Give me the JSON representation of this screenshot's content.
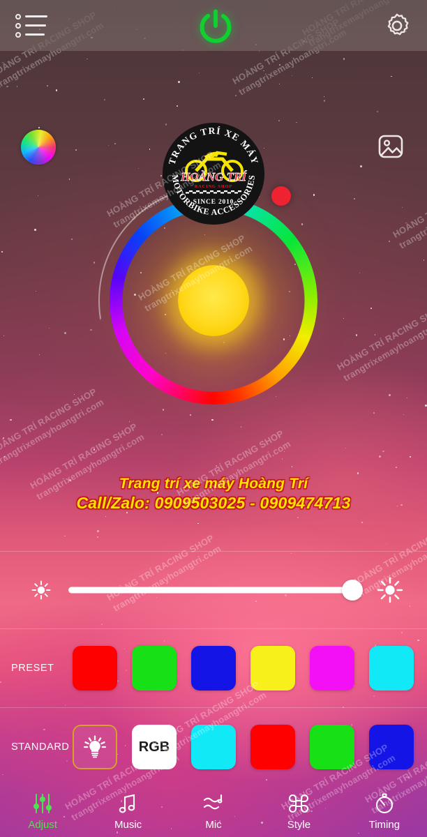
{
  "topbar": {
    "menu_icon": "list-menu-icon",
    "power_icon": "power-icon",
    "settings_icon": "gear-icon"
  },
  "header": {
    "color_wheel_icon": "color-wheel-icon",
    "gallery_icon": "image-gallery-icon",
    "logo": {
      "top_arc": "TRANG TRÍ XE MÁY",
      "bottom_arc": "MOTORBIKE ACCESSORIES",
      "brand": "HOÀNG TRÍ",
      "sub_brand": "RACING SHOP",
      "since": "SINCE 2010",
      "brand_color": "#e5182a",
      "accent_color": "#f5e400",
      "background_color": "#131313"
    }
  },
  "color_wheel": {
    "handle_color": "#ef2233",
    "handle_angle_deg": 45,
    "center_color": "#ffd91f",
    "selected_hue": "yellow"
  },
  "promo": {
    "line1": "Trang trí xe máy Hoàng Trí",
    "line2": "Call/Zalo: 0909503025 - 0909474713",
    "text_color": "#ffe000",
    "outline_color": "#c21717"
  },
  "brightness": {
    "low_icon": "sun-small-icon",
    "high_icon": "sun-large-icon",
    "value_percent": 96
  },
  "preset": {
    "label": "PRESET",
    "colors": [
      "#ff0000",
      "#17e017",
      "#1414e6",
      "#f7f01a",
      "#f410f4",
      "#12e9f7"
    ]
  },
  "standard": {
    "label": "STANDARD",
    "items": [
      {
        "type": "icon",
        "name": "bulb-icon",
        "selected": true,
        "border_color": "#d5a12a"
      },
      {
        "type": "text",
        "name": "rgb-button",
        "label": "RGB",
        "background": "#ffffff",
        "text_color": "#1d1d1d"
      },
      {
        "type": "color",
        "name": "swatch-cyan",
        "color": "#12e9f7"
      },
      {
        "type": "color",
        "name": "swatch-red",
        "color": "#ff0000"
      },
      {
        "type": "color",
        "name": "swatch-green",
        "color": "#17e017"
      },
      {
        "type": "color",
        "name": "swatch-blue",
        "color": "#1414e6"
      }
    ]
  },
  "bottom_nav": {
    "active_color": "#4ee24e",
    "inactive_color": "#ffffff",
    "items": [
      {
        "label": "Adjust",
        "icon": "sliders-icon",
        "active": true
      },
      {
        "label": "Music",
        "icon": "music-note-icon",
        "active": false
      },
      {
        "label": "Mic",
        "icon": "mic-wave-icon",
        "active": false
      },
      {
        "label": "Style",
        "icon": "command-icon",
        "active": false
      },
      {
        "label": "Timing",
        "icon": "stopwatch-icon",
        "active": false
      }
    ]
  },
  "watermarks": {
    "line1": "HOÀNG TRÍ RACING SHOP",
    "line2": "trangtrixemayhoangtri.com"
  }
}
